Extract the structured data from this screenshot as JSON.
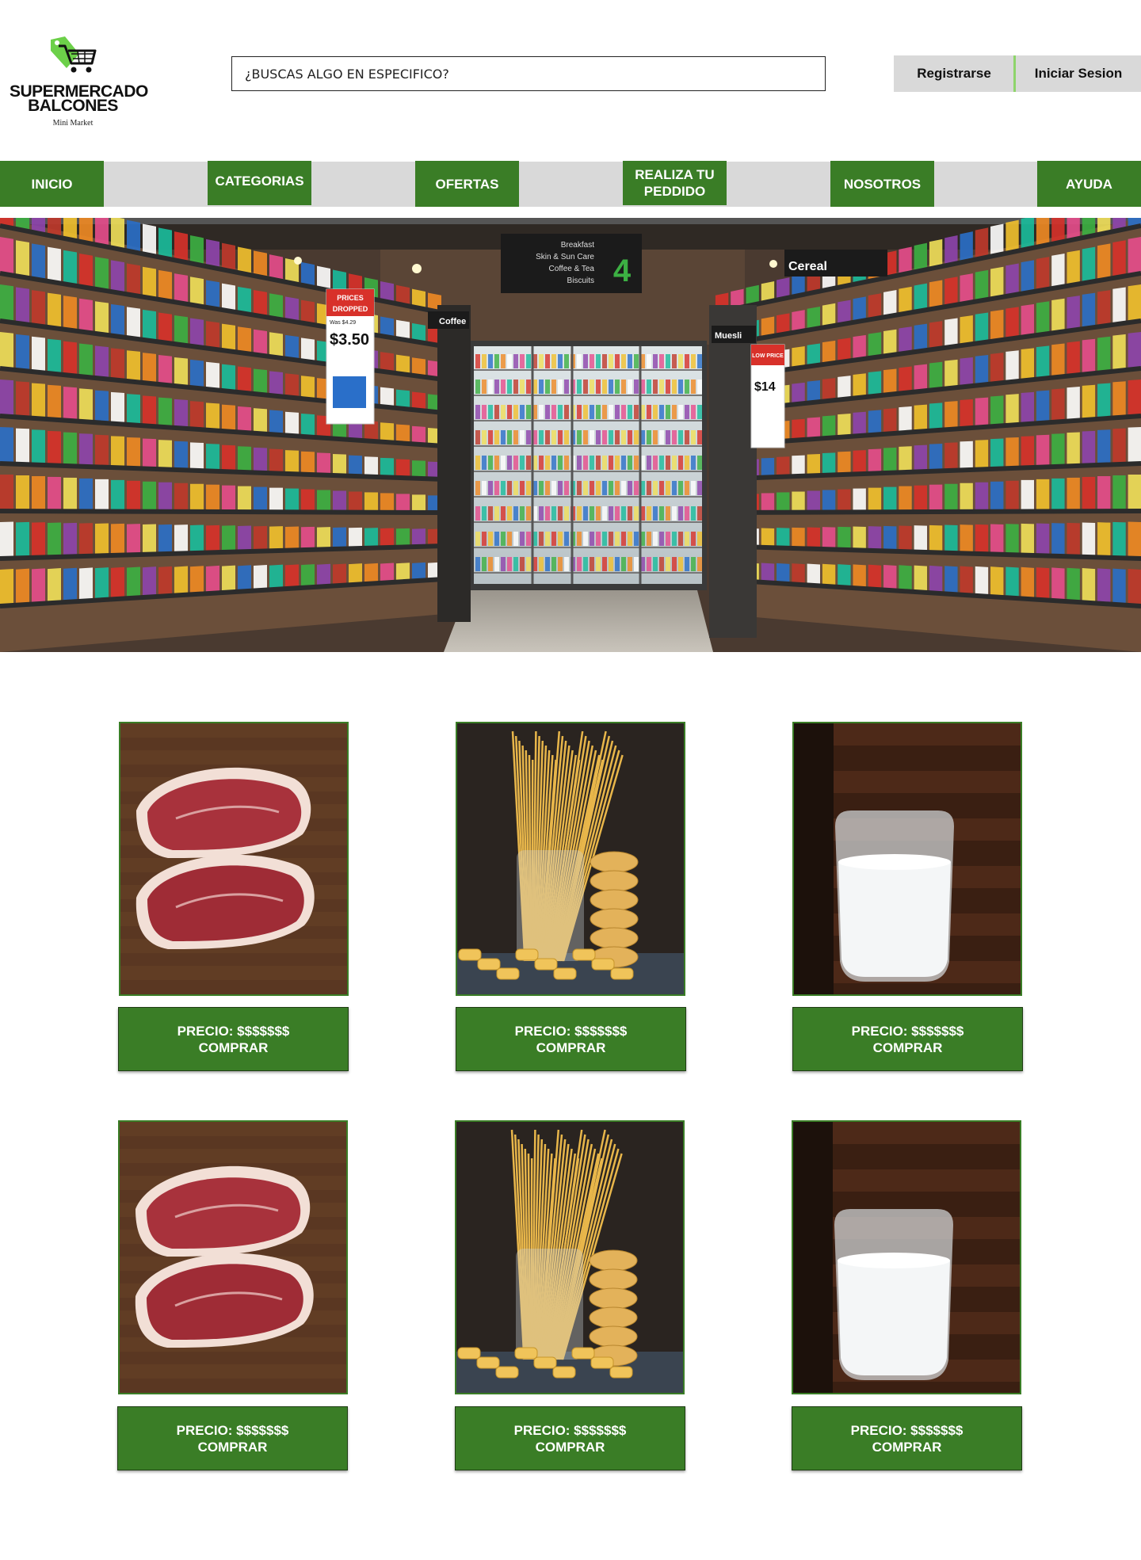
{
  "brand": {
    "name_line1": "SUPERMERCADO",
    "name_line2": "BALCONES",
    "tagline": "Mini Market",
    "logo_icon": "shopping-cart-tag-icon",
    "accent": "#3a7d26",
    "logo_green": "#6cd049"
  },
  "search": {
    "placeholder": "¿BUSCAS ALGO EN ESPECIFICO?"
  },
  "auth": {
    "register": "Registrarse",
    "login": "Iniciar Sesion"
  },
  "nav": [
    "INICIO",
    "CATEGORIAS",
    "OFERTAS",
    "REALIZA TU PEDDIDO",
    "NOSOTROS",
    "AYUDA"
  ],
  "hero": {
    "image": "supermarket-aisle-photo",
    "aisle_sign": [
      "Breakfast",
      "Skin & Sun Care",
      "Coffee & Tea",
      "Biscuits"
    ],
    "aisle_number": "4",
    "signs": [
      "Cereal",
      "Coffee",
      "Muesli"
    ],
    "price_tag": {
      "header": "PRICES DROPPED",
      "was": "Was $4.29",
      "price": "$3.50"
    },
    "low_price_tag": {
      "header": "LOW PRICE ALWAYS",
      "price": "$14"
    }
  },
  "products": [
    {
      "image": "beef-steak-photo",
      "price_label": "PRECIO: $$$$$$$",
      "action_label": "COMPRAR"
    },
    {
      "image": "pasta-jar-photo",
      "price_label": "PRECIO: $$$$$$$",
      "action_label": "COMPRAR"
    },
    {
      "image": "milk-glass-photo",
      "price_label": "PRECIO: $$$$$$$",
      "action_label": "COMPRAR"
    },
    {
      "image": "beef-steak-photo",
      "price_label": "PRECIO: $$$$$$$",
      "action_label": "COMPRAR"
    },
    {
      "image": "pasta-jar-photo",
      "price_label": "PRECIO: $$$$$$$",
      "action_label": "COMPRAR"
    },
    {
      "image": "milk-glass-photo",
      "price_label": "PRECIO: $$$$$$$",
      "action_label": "COMPRAR"
    }
  ]
}
